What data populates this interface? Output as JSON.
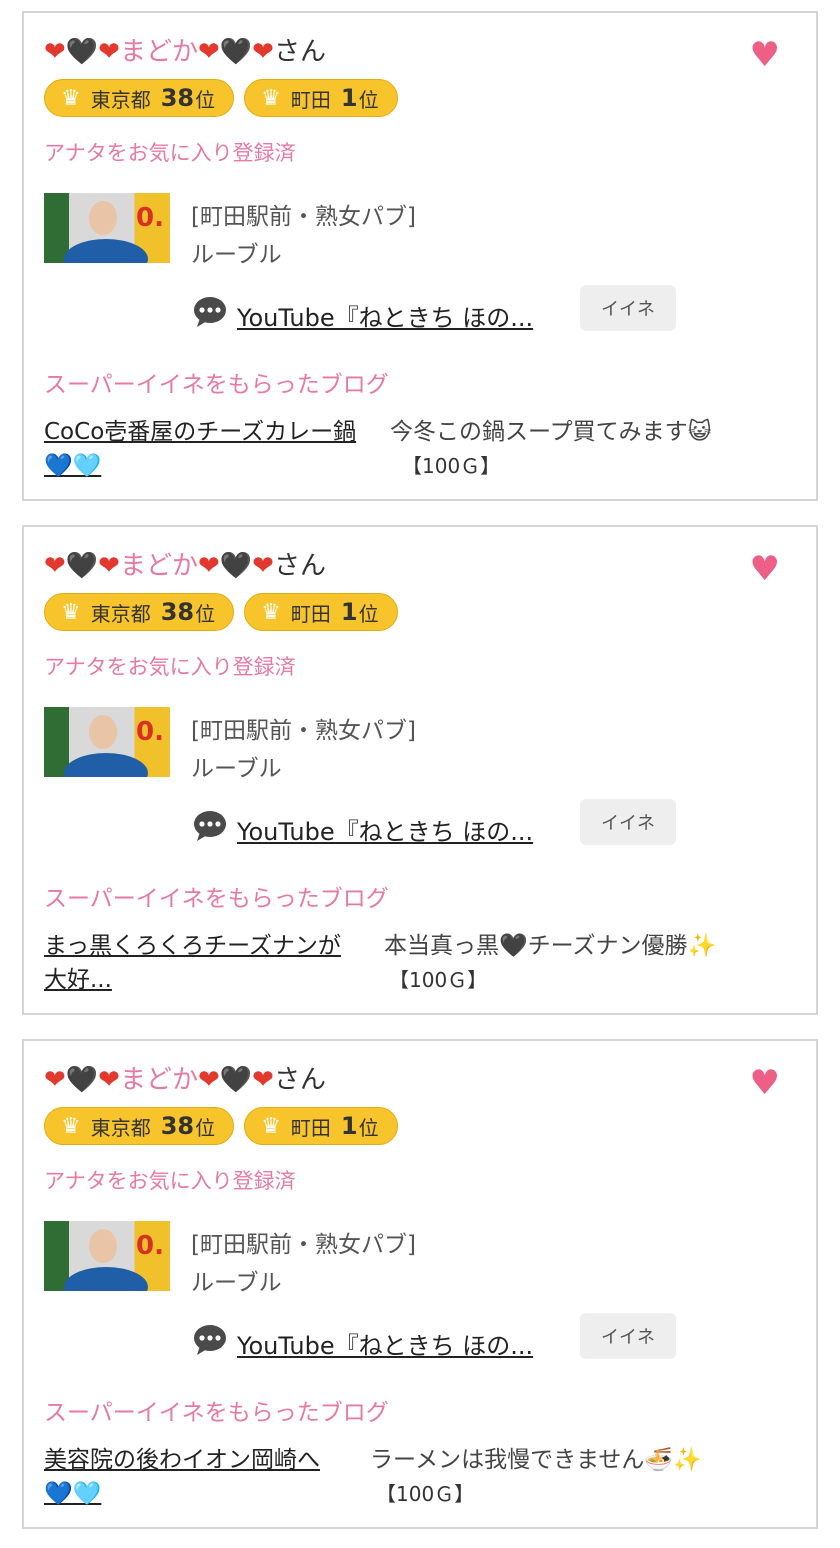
{
  "cards": [
    {
      "user": {
        "h1": "❤",
        "h2": "🖤",
        "h3": "❤",
        "name": "まどか",
        "h4": "❤",
        "h5": "🖤",
        "h6": "❤",
        "suffix": "さん"
      },
      "fav_icon": "heart-icon",
      "badges": [
        {
          "crown": "♛",
          "region": "東京都",
          "rank": "38",
          "unit": "位"
        },
        {
          "crown": "♛",
          "region": "町田",
          "rank": "1",
          "unit": "位"
        }
      ],
      "favorite_status": "アナタをお気に入り登録済",
      "shop": {
        "category": "[町田駅前・熟女パブ]",
        "name": "ルーブル"
      },
      "comment": {
        "text": "YouTube『ねときち ほの...",
        "like_label": "イイネ"
      },
      "super_like_heading": "スーパーイイネをもらったブログ",
      "blog": {
        "title_l1": "CoCo壱番屋のチーズカレー鍋",
        "title_l2": "💙🩵",
        "desc": "今冬この鍋スープ買てみます😺",
        "points": "【100Ｇ】"
      }
    },
    {
      "user": {
        "h1": "❤",
        "h2": "🖤",
        "h3": "❤",
        "name": "まどか",
        "h4": "❤",
        "h5": "🖤",
        "h6": "❤",
        "suffix": "さん"
      },
      "fav_icon": "heart-icon",
      "badges": [
        {
          "crown": "♛",
          "region": "東京都",
          "rank": "38",
          "unit": "位"
        },
        {
          "crown": "♛",
          "region": "町田",
          "rank": "1",
          "unit": "位"
        }
      ],
      "favorite_status": "アナタをお気に入り登録済",
      "shop": {
        "category": "[町田駅前・熟女パブ]",
        "name": "ルーブル"
      },
      "comment": {
        "text": "YouTube『ねときち ほの...",
        "like_label": "イイネ"
      },
      "super_like_heading": "スーパーイイネをもらったブログ",
      "blog": {
        "title_l1": "まっ黒くろくろチーズナンが",
        "title_l2": "大好...",
        "desc": "本当真っ黒🖤チーズナン優勝✨",
        "points": "【100Ｇ】"
      }
    },
    {
      "user": {
        "h1": "❤",
        "h2": "🖤",
        "h3": "❤",
        "name": "まどか",
        "h4": "❤",
        "h5": "🖤",
        "h6": "❤",
        "suffix": "さん"
      },
      "fav_icon": "heart-icon",
      "badges": [
        {
          "crown": "♛",
          "region": "東京都",
          "rank": "38",
          "unit": "位"
        },
        {
          "crown": "♛",
          "region": "町田",
          "rank": "1",
          "unit": "位"
        }
      ],
      "favorite_status": "アナタをお気に入り登録済",
      "shop": {
        "category": "[町田駅前・熟女パブ]",
        "name": "ルーブル"
      },
      "comment": {
        "text": "YouTube『ねときち ほの...",
        "like_label": "イイネ"
      },
      "super_like_heading": "スーパーイイネをもらったブログ",
      "blog": {
        "title_l1": "美容院の後わイオン岡崎へ",
        "title_l2": "💙🩵",
        "desc": "ラーメンは我慢できません🍜✨",
        "points": "【100Ｇ】"
      }
    }
  ]
}
